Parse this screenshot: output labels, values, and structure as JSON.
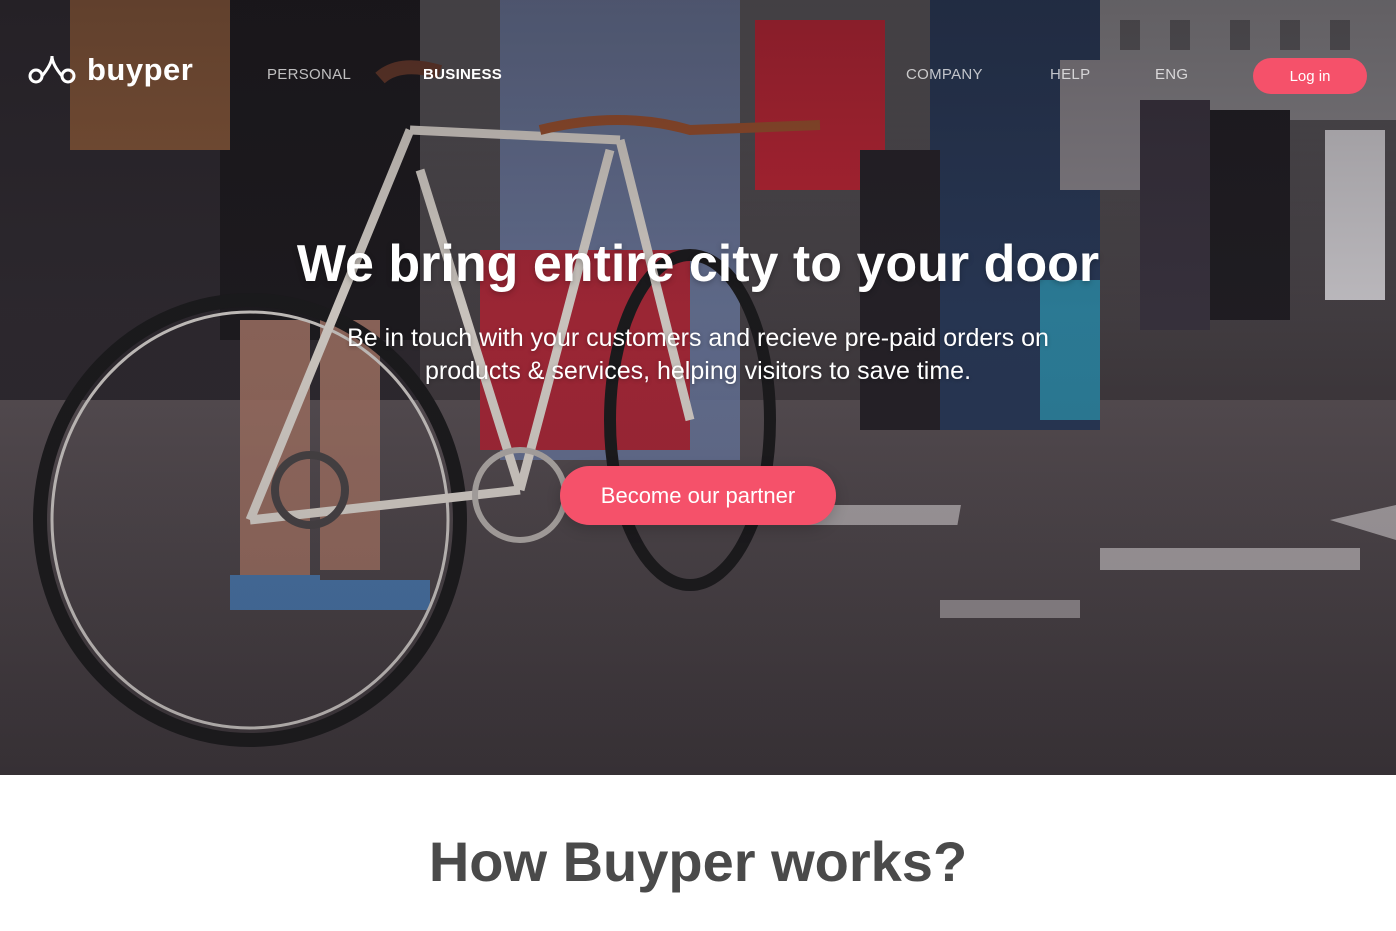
{
  "nav": {
    "logo_text": "buyper",
    "links": [
      {
        "label": "PERSONAL",
        "active": false
      },
      {
        "label": "BUSINESS",
        "active": true
      },
      {
        "label": "COMPANY",
        "active": false
      },
      {
        "label": "HELP",
        "active": false
      }
    ],
    "language": "ENG",
    "login_label": "Log in"
  },
  "hero": {
    "title": "We bring entire city to your door",
    "subtitle": "Be in touch with your customers and recieve pre-paid orders on products & services, helping visitors to save time.",
    "cta_label": "Become our partner",
    "background_icon": "bicycle-queue-photo"
  },
  "how": {
    "title": "How Buyper works?",
    "subtitle": ""
  },
  "colors": {
    "accent": "#f5516a",
    "heading_gray": "#4a4a4a",
    "white": "#ffffff"
  }
}
